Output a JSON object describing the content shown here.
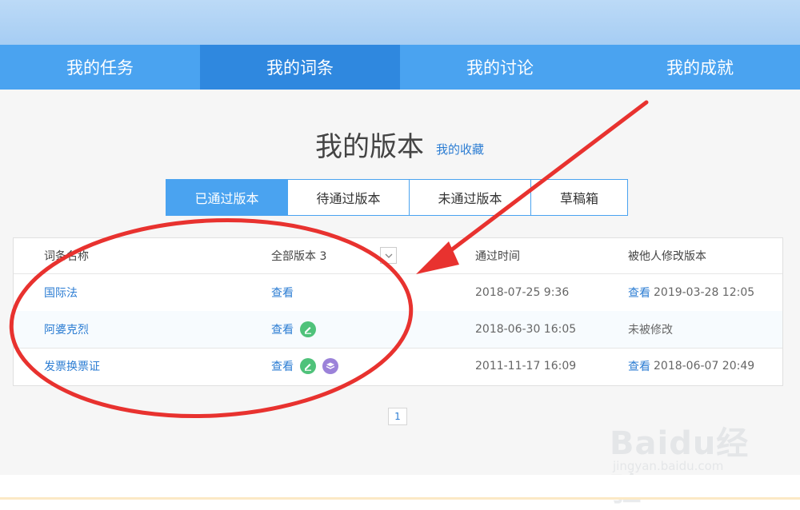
{
  "nav": {
    "items": [
      {
        "label": "我的任务"
      },
      {
        "label": "我的词条"
      },
      {
        "label": "我的讨论"
      },
      {
        "label": "我的成就"
      }
    ]
  },
  "page": {
    "title": "我的版本",
    "favorites_link": "我的收藏"
  },
  "tabs": [
    {
      "label": "已通过版本"
    },
    {
      "label": "待通过版本"
    },
    {
      "label": "未通过版本"
    },
    {
      "label": "草稿箱"
    }
  ],
  "table": {
    "headers": {
      "name": "词条名称",
      "versions": "全部版本 3",
      "time": "通过时间",
      "modified": "被他人修改版本"
    },
    "rows": [
      {
        "name": "国际法",
        "view": "查看",
        "time": "2018-07-25 9:36",
        "mod_link": "查看",
        "mod_text": "2019-03-28 12:05",
        "icons": []
      },
      {
        "name": "阿婆克烈",
        "view": "查看",
        "time": "2018-06-30 16:05",
        "mod_link": "",
        "mod_text": "未被修改",
        "icons": [
          "edit-icon"
        ]
      },
      {
        "name": "发票换票证",
        "view": "查看",
        "time": "2011-11-17 16:09",
        "mod_link": "查看",
        "mod_text": "2018-06-07 20:49",
        "icons": [
          "edit-icon",
          "layers-icon"
        ]
      }
    ]
  },
  "pagination": {
    "current": "1"
  },
  "watermark": {
    "brand": "Baidu经验",
    "url": "jingyan.baidu.com"
  },
  "colors": {
    "nav_bg": "#4aa3f0",
    "nav_active": "#2f88df",
    "link": "#2c7dd3",
    "annotation": "#e8322f"
  }
}
